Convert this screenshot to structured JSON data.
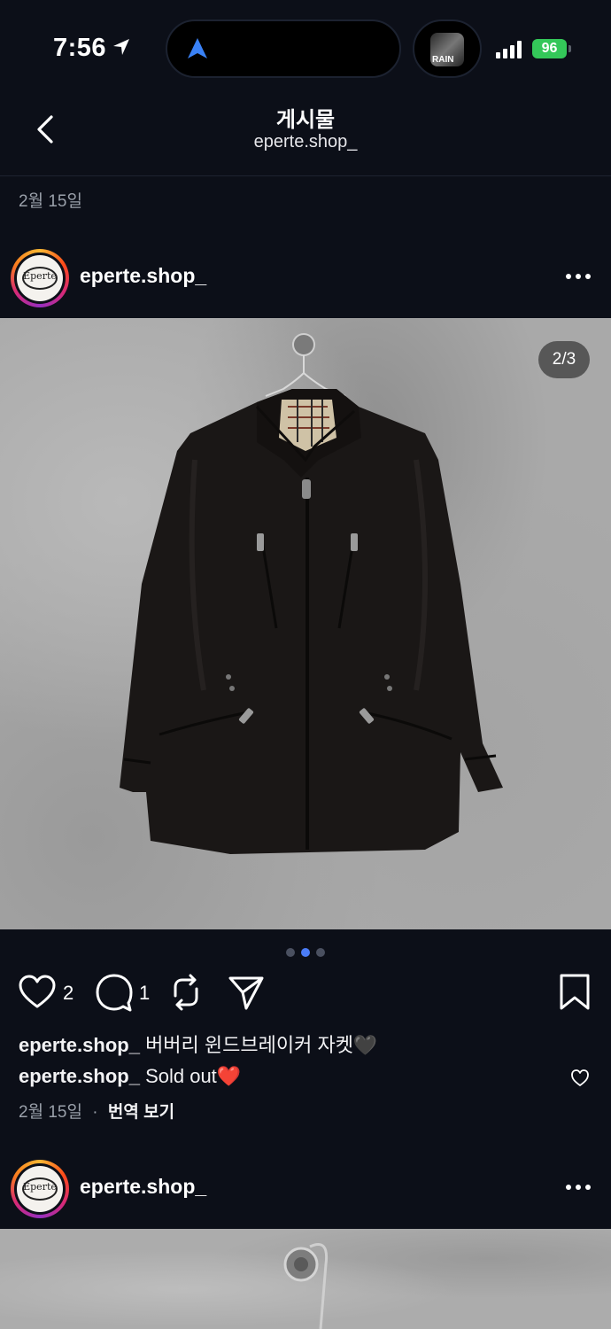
{
  "status_bar": {
    "time": "7:56",
    "battery": "96",
    "album_text": "RAIN"
  },
  "header": {
    "title": "게시물",
    "subtitle": "eperte.shop_"
  },
  "previous_post": {
    "date": "2월 15일"
  },
  "post": {
    "username": "eperte.shop_",
    "avatar_logo_text": "Eperte",
    "image_counter": "2/3",
    "carousel": {
      "total": 3,
      "active": 1
    },
    "likes": "2",
    "comments": "1",
    "caption_user": "eperte.shop_",
    "caption_text": "버버리 윈드브레이커 자켓🖤",
    "comment_user": "eperte.shop_",
    "comment_text": "Sold out❤️",
    "date": "2월 15일",
    "separator": "·",
    "translate": "번역 보기"
  },
  "next_post": {
    "username": "eperte.shop_",
    "avatar_logo_text": "Eperte"
  },
  "colors": {
    "background": "#0c0f18",
    "active_dot": "#4a7cf7",
    "battery": "#34c759"
  },
  "icons": [
    "location-arrow-icon",
    "signal-icon",
    "back-chevron-icon",
    "more-icon",
    "heart-icon",
    "comment-icon",
    "repost-icon",
    "share-icon",
    "bookmark-icon"
  ]
}
